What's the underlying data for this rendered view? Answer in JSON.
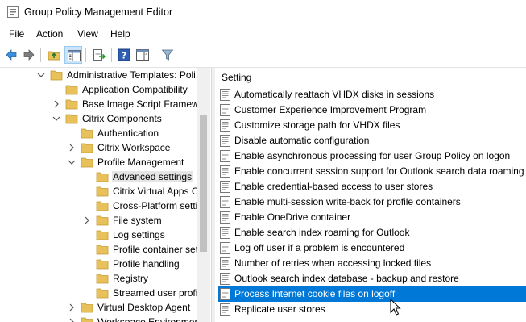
{
  "window": {
    "title": "Group Policy Management Editor",
    "icon": "group-policy-icon"
  },
  "menu": [
    "File",
    "Action",
    "View",
    "Help"
  ],
  "toolbar": [
    "back-arrow-icon",
    "forward-arrow-icon",
    "up-folder-icon",
    "show-hide-tree-icon",
    "export-list-icon",
    "help-icon",
    "properties-panel-icon",
    "filter-icon"
  ],
  "tree": [
    {
      "label": "Administrative Templates: Poli",
      "expander": "expanded",
      "indent": 1
    },
    {
      "label": "Application Compatibility",
      "expander": "none",
      "indent": 2
    },
    {
      "label": "Base Image Script Framewo",
      "expander": "collapsed",
      "indent": 2
    },
    {
      "label": "Citrix Components",
      "expander": "expanded",
      "indent": 2
    },
    {
      "label": "Authentication",
      "expander": "none",
      "indent": 3
    },
    {
      "label": "Citrix Workspace",
      "expander": "collapsed",
      "indent": 3
    },
    {
      "label": "Profile Management",
      "expander": "expanded",
      "indent": 3
    },
    {
      "label": "Advanced settings",
      "expander": "none",
      "indent": 4,
      "selected": true
    },
    {
      "label": "Citrix Virtual Apps C",
      "expander": "none",
      "indent": 4
    },
    {
      "label": "Cross-Platform setti",
      "expander": "none",
      "indent": 4
    },
    {
      "label": "File system",
      "expander": "collapsed",
      "indent": 4
    },
    {
      "label": "Log settings",
      "expander": "none",
      "indent": 4
    },
    {
      "label": "Profile container set",
      "expander": "none",
      "indent": 4
    },
    {
      "label": "Profile handling",
      "expander": "none",
      "indent": 4
    },
    {
      "label": "Registry",
      "expander": "none",
      "indent": 4
    },
    {
      "label": "Streamed user profi",
      "expander": "none",
      "indent": 4
    },
    {
      "label": "Virtual Desktop Agent",
      "expander": "collapsed",
      "indent": 3
    },
    {
      "label": "Workspace Environmen",
      "expander": "collapsed",
      "indent": 3
    }
  ],
  "settings": {
    "column_header": "Setting",
    "items": [
      {
        "label": "Automatically reattach VHDX disks in sessions"
      },
      {
        "label": "Customer Experience Improvement Program"
      },
      {
        "label": "Customize storage path for VHDX files"
      },
      {
        "label": "Disable automatic configuration"
      },
      {
        "label": "Enable asynchronous processing for user Group Policy on logon"
      },
      {
        "label": "Enable concurrent session support for Outlook search data roaming"
      },
      {
        "label": "Enable credential-based access to user stores"
      },
      {
        "label": "Enable multi-session write-back for profile containers"
      },
      {
        "label": "Enable OneDrive container"
      },
      {
        "label": "Enable search index roaming for Outlook"
      },
      {
        "label": "Log off user if a problem is encountered"
      },
      {
        "label": "Number of retries when accessing locked files"
      },
      {
        "label": "Outlook search index database - backup and restore"
      },
      {
        "label": "Process Internet cookie files on logoff",
        "selected": true
      },
      {
        "label": "Replicate user stores"
      }
    ]
  },
  "colors": {
    "selection": "#0078d7",
    "tree_selection": "#e5e5e5",
    "folder": "#e8c15a"
  }
}
